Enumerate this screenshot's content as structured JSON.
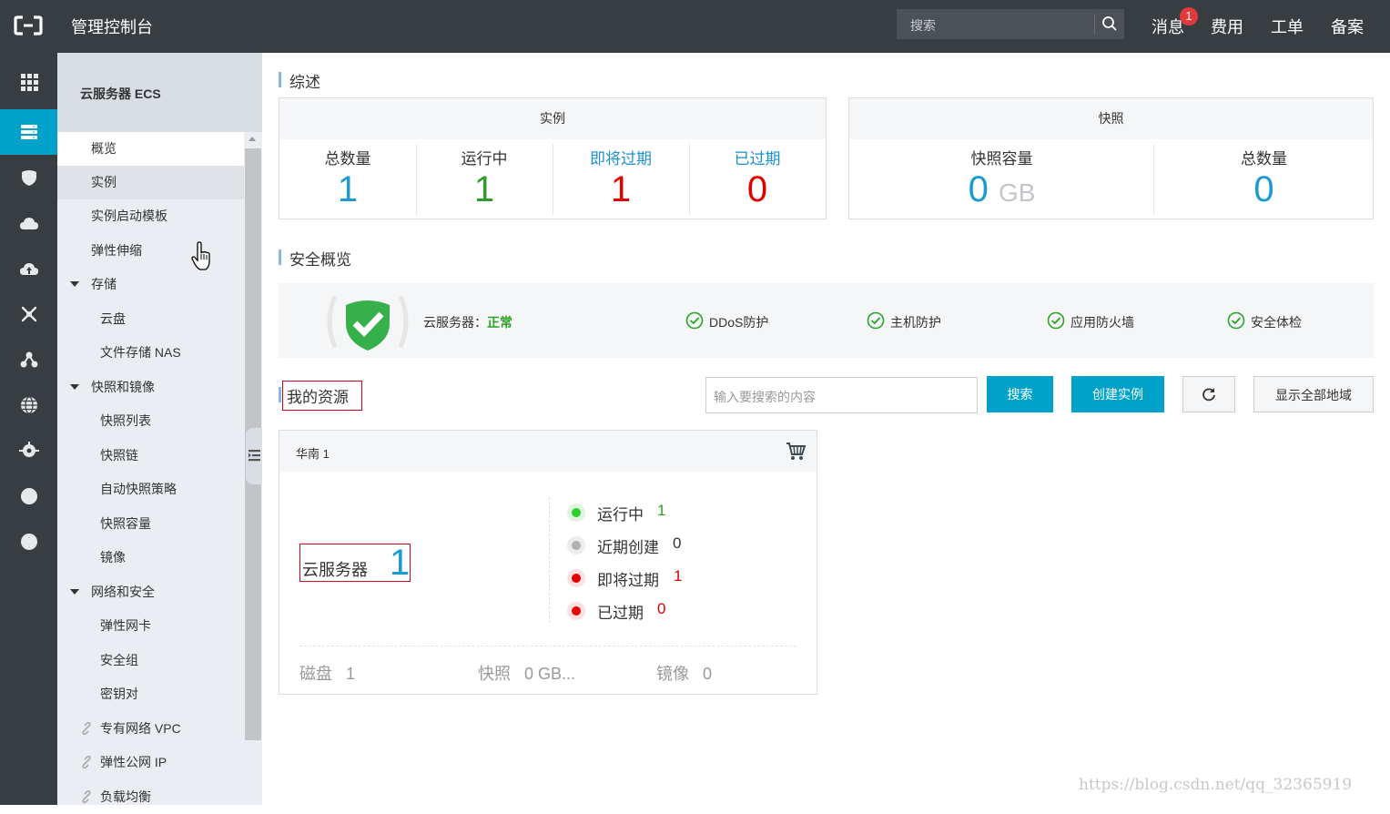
{
  "topbar": {
    "title": "管理控制台",
    "search_placeholder": "搜索",
    "links": [
      "消息",
      "费用",
      "工单",
      "备案"
    ],
    "badge": "1"
  },
  "iconbar": {
    "icons": [
      "grid-icon",
      "server-icon",
      "shield-icon",
      "cloud-icon",
      "cloud-upload-icon",
      "network-icon",
      "nodes-icon",
      "globe-icon",
      "gear-cloud-icon",
      "circle-icon",
      "circle-icon"
    ]
  },
  "sidebar": {
    "title": "云服务器 ECS",
    "items": [
      {
        "label": "概览"
      },
      {
        "label": "实例"
      },
      {
        "label": "实例启动模板"
      },
      {
        "label": "弹性伸缩"
      },
      {
        "label": "存储"
      },
      {
        "label": "云盘"
      },
      {
        "label": "文件存储 NAS"
      },
      {
        "label": "快照和镜像"
      },
      {
        "label": "快照列表"
      },
      {
        "label": "快照链"
      },
      {
        "label": "自动快照策略"
      },
      {
        "label": "快照容量"
      },
      {
        "label": "镜像"
      },
      {
        "label": "网络和安全"
      },
      {
        "label": "弹性网卡"
      },
      {
        "label": "安全组"
      },
      {
        "label": "密钥对"
      },
      {
        "label": "专有网络 VPC"
      },
      {
        "label": "弹性公网 IP"
      },
      {
        "label": "负载均衡"
      }
    ]
  },
  "overview": {
    "title": "综述",
    "instances": {
      "header": "实例",
      "stats": [
        {
          "label": "总数量",
          "value": "1"
        },
        {
          "label": "运行中",
          "value": "1"
        },
        {
          "label": "即将过期",
          "value": "1"
        },
        {
          "label": "已过期",
          "value": "0"
        }
      ]
    },
    "snapshots": {
      "header": "快照",
      "capacity_label": "快照容量",
      "capacity_value": "0",
      "capacity_unit": "GB",
      "count_label": "总数量",
      "count_value": "0"
    }
  },
  "security": {
    "title": "安全概览",
    "status_label": "云服务器：",
    "status_value": "正常",
    "checks": [
      "DDoS防护",
      "主机防护",
      "应用防火墙",
      "安全体检"
    ]
  },
  "resources": {
    "title": "我的资源",
    "search_placeholder": "输入要搜索的内容",
    "search_button": "搜索",
    "create_button": "创建实例",
    "show_all_button": "显示全部地域",
    "region": "华南 1",
    "server_label": "云服务器",
    "server_count": "1",
    "legend": [
      {
        "label": "运行中",
        "value": "1"
      },
      {
        "label": "近期创建",
        "value": "0"
      },
      {
        "label": "即将过期",
        "value": "1"
      },
      {
        "label": "已过期",
        "value": "0"
      }
    ],
    "footer": [
      {
        "label": "磁盘",
        "value": "1"
      },
      {
        "label": "快照",
        "value": "0 GB..."
      },
      {
        "label": "镜像",
        "value": "0"
      }
    ]
  },
  "watermark": "https://blog.csdn.net/qq_32365919",
  "colors": {
    "topbar": "#373d41",
    "accent": "#00a2ca",
    "blue_value": "#1b9bd1",
    "green_value": "#2e9d2e",
    "red_value": "#e00000",
    "ok_green": "#2aa328"
  }
}
